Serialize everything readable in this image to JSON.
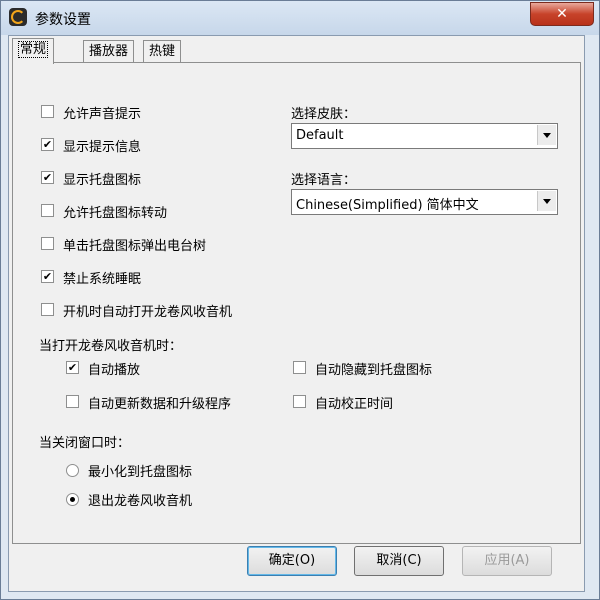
{
  "window": {
    "title": "参数设置",
    "close_label": "✕"
  },
  "tabs": [
    {
      "label": "常规",
      "active": true
    },
    {
      "label": "播放器",
      "active": false
    },
    {
      "label": "热键",
      "active": false
    }
  ],
  "general": {
    "checkboxes": [
      {
        "label": "允许声音提示",
        "checked": false
      },
      {
        "label": "显示提示信息",
        "checked": true
      },
      {
        "label": "显示托盘图标",
        "checked": true
      },
      {
        "label": "允许托盘图标转动",
        "checked": false
      },
      {
        "label": "单击托盘图标弹出电台树",
        "checked": false
      },
      {
        "label": "禁止系统睡眠",
        "checked": true
      },
      {
        "label": "开机时自动打开龙卷风收音机",
        "checked": false
      }
    ],
    "skin_label": "选择皮肤：",
    "skin_value": "Default",
    "language_label": "选择语言：",
    "language_value": "Chinese(Simplified) 简体中文",
    "on_open_title": "当打开龙卷风收音机时：",
    "on_open": [
      {
        "label": "自动播放",
        "checked": true
      },
      {
        "label": "自动隐藏到托盘图标",
        "checked": false
      },
      {
        "label": "自动更新数据和升级程序",
        "checked": false
      },
      {
        "label": "自动校正时间",
        "checked": false
      }
    ],
    "on_close_title": "当关闭窗口时：",
    "on_close": [
      {
        "label": "最小化到托盘图标",
        "selected": false
      },
      {
        "label": "退出龙卷风收音机",
        "selected": true
      }
    ]
  },
  "buttons": {
    "ok": "确定(O)",
    "cancel": "取消(C)",
    "apply": "应用(A)"
  }
}
